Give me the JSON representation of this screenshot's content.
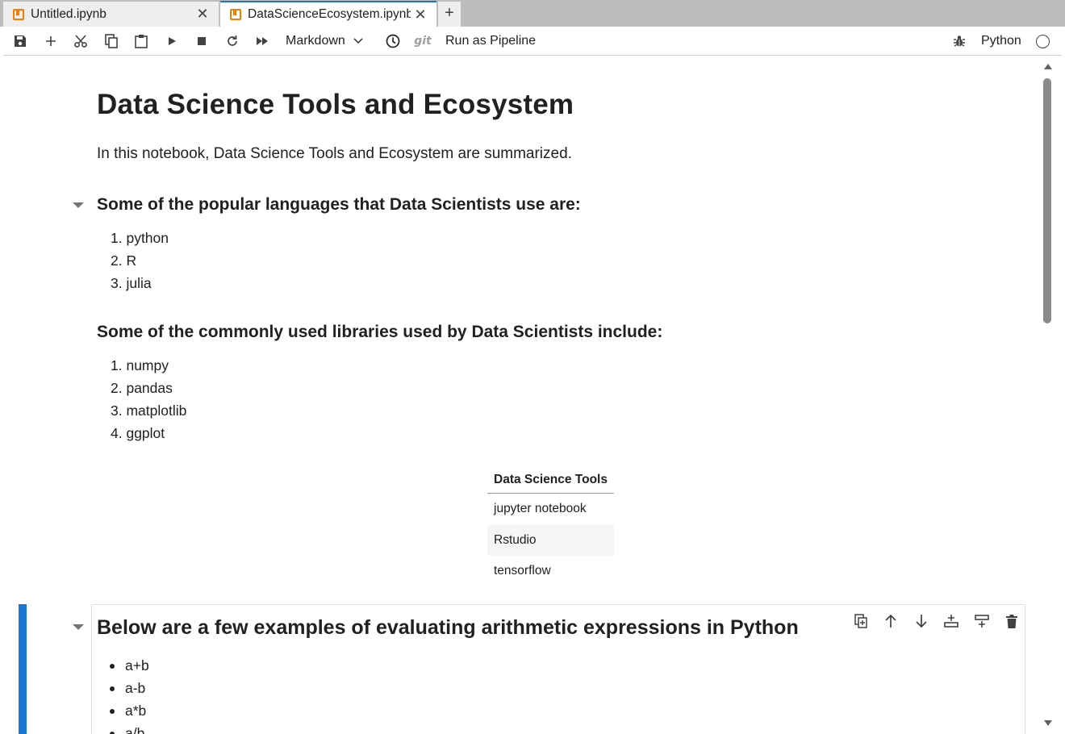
{
  "tabs": [
    {
      "label": "Untitled.ipynb",
      "close": "✕"
    },
    {
      "label": "DataScienceEcosystem.ipynb",
      "close": "✕"
    }
  ],
  "new_tab_label": "+",
  "toolbar": {
    "cell_type": "Markdown",
    "git_label": "git",
    "pipeline_label": "Run as Pipeline",
    "kernel_name": "Python"
  },
  "notebook": {
    "title": "Data Science Tools and Ecosystem",
    "intro": "In this notebook, Data Science Tools and Ecosystem are summarized.",
    "languages_heading": "Some of the popular languages that Data Scientists use are:",
    "languages": [
      "1. python",
      "2. R",
      "3. julia"
    ],
    "libraries_heading": "Some of the commonly used libraries used by Data Scientists include:",
    "libraries": [
      "1. numpy",
      "2. pandas",
      "3. matplotlib",
      "4. ggplot"
    ],
    "tools_table": {
      "header": "Data Science Tools",
      "rows": [
        "jupyter notebook",
        "Rstudio",
        "tensorflow"
      ]
    },
    "arith_heading": "Below are a few examples of evaluating arithmetic expressions in Python",
    "arith_examples": [
      "a+b",
      "a-b",
      "a*b",
      "a/b"
    ]
  },
  "colors": {
    "accent": "#1976d2",
    "notebook_icon": "#f57c00"
  },
  "icons": [
    "save-icon",
    "add-icon",
    "cut-icon",
    "copy-icon",
    "paste-icon",
    "run-icon",
    "stop-icon",
    "restart-icon",
    "fast-forward-icon",
    "clock-icon",
    "bug-icon"
  ]
}
